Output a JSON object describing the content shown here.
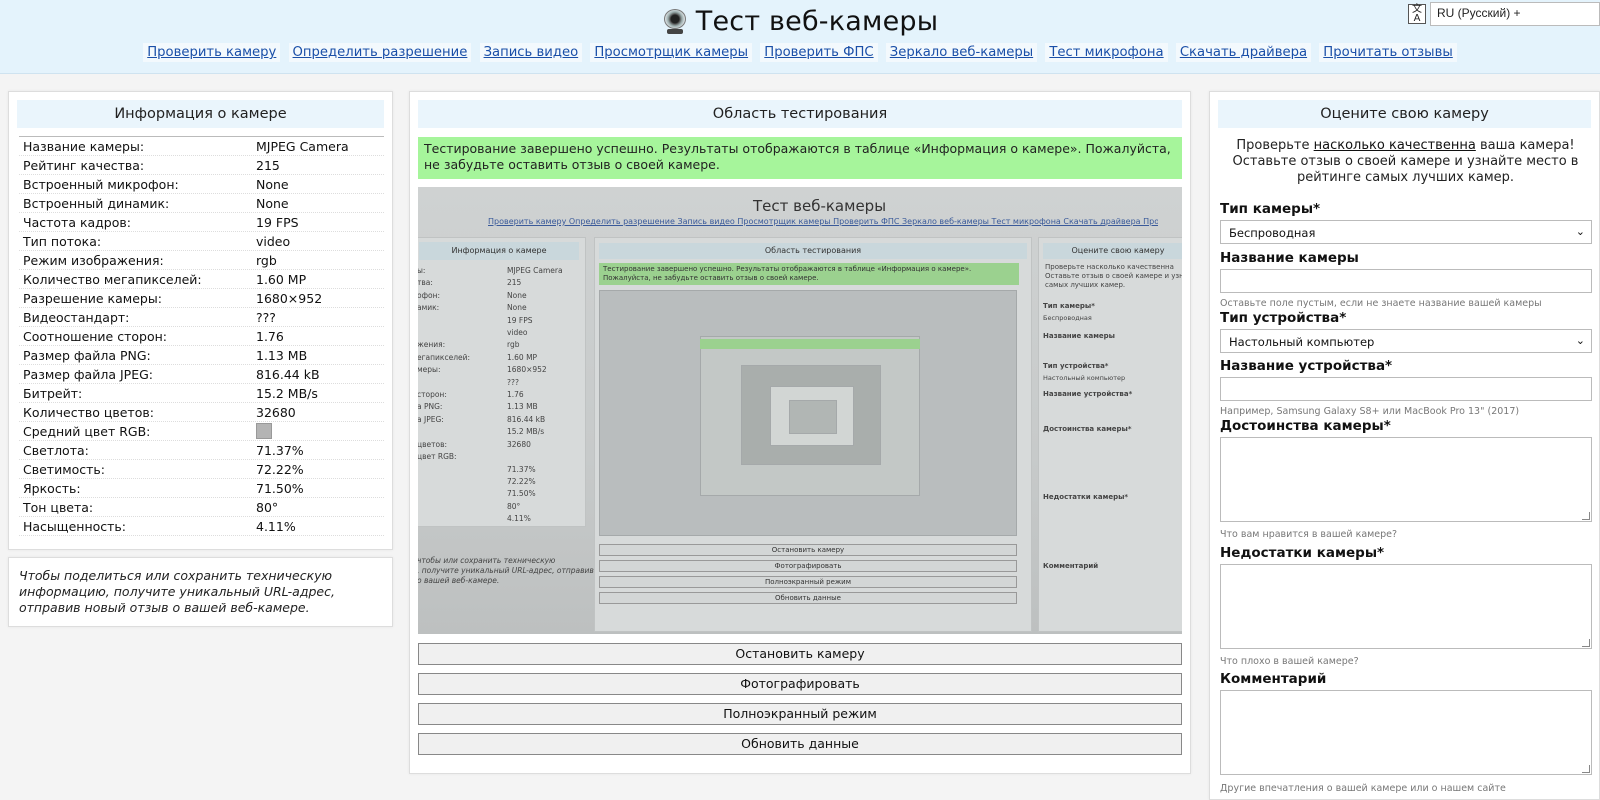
{
  "header": {
    "title": "Тест веб-камеры",
    "nav": [
      "Проверить камеру",
      "Определить разрешение",
      "Запись видео",
      "Просмотрщик камеры",
      "Проверить ФПС",
      "Зеркало веб-камеры",
      "Тест микрофона",
      "Скачать драйвера",
      "Прочитать отзывы"
    ],
    "lang_icon": "translate-icon",
    "lang_select": "RU (Русский) +"
  },
  "info": {
    "title": "Информация о камере",
    "rows": [
      {
        "k": "Название камеры:",
        "v": "MJPEG Camera"
      },
      {
        "k": "Рейтинг качества:",
        "v": "215"
      },
      {
        "k": "Встроенный микрофон:",
        "v": "None"
      },
      {
        "k": "Встроенный динамик:",
        "v": "None"
      },
      {
        "k": "Частота кадров:",
        "v": "19 FPS"
      },
      {
        "k": "Тип потока:",
        "v": "video"
      },
      {
        "k": "Режим изображения:",
        "v": "rgb"
      },
      {
        "k": "Количество мегапикселей:",
        "v": "1.60 MP"
      },
      {
        "k": "Разрешение камеры:",
        "v": "1680×952"
      },
      {
        "k": "Видеостандарт:",
        "v": "???"
      },
      {
        "k": "Соотношение сторон:",
        "v": "1.76"
      },
      {
        "k": "Размер файла PNG:",
        "v": "1.13 MB"
      },
      {
        "k": "Размер файла JPEG:",
        "v": "816.44 kB"
      },
      {
        "k": "Битрейт:",
        "v": "15.2 MB/s"
      },
      {
        "k": "Количество цветов:",
        "v": "32680"
      },
      {
        "k": "Средний цвет RGB:",
        "v": ""
      },
      {
        "k": "Светлота:",
        "v": "71.37%"
      },
      {
        "k": "Светимость:",
        "v": "72.22%"
      },
      {
        "k": "Яркость:",
        "v": "71.50%"
      },
      {
        "k": "Тон цвета:",
        "v": "80°"
      },
      {
        "k": "Насыщенность:",
        "v": "4.11%"
      }
    ],
    "avg_rgb_color": "#b4b4b4",
    "note": "Чтобы поделиться или сохранить техническую информацию, получите уникальный URL-адрес, отправив новый отзыв о вашей веб-камере."
  },
  "test": {
    "title": "Область тестирования",
    "success": "Тестирование завершено успешно. Результаты отображаются в таблице «Информация о камере». Пожалуйста, не забудьте оставить отзыв о своей камере.",
    "buttons": [
      "Остановить камеру",
      "Фотографировать",
      "Полноэкранный режим",
      "Обновить данные"
    ],
    "preview_nested": {
      "title": "Тест веб-камеры",
      "nav": "Проверить камеру   Определить разрешение   Запись видео   Просмотрщик камеры   Проверить ФПС   Зеркало веб-камеры   Тест микрофона   Скачать драйвера   Прочитать отзывы",
      "info_head": "Информация о камере",
      "area_head": "Область тестирования",
      "rate_head": "Оцените свою камеру",
      "green": "Тестирование завершено успешно. Результаты отображаются в таблице «Информация о камере». Пожалуйста, не забудьте оставить отзыв о своей камере.",
      "labels": "ы:\nтва:\nофон:\nамик:\n\n\nжения:\nегапикселей:\nмеры:\n\nсторон:\nа PNG:\nа JPEG:\n\nцветов:\nцвет RGB:",
      "values": "MJPEG Camera\n215\nNone\nNone\n19 FPS\nvideo\nrgb\n1.60 MP\n1680×952\n???\n1.76\n1.13 MB\n816.44 kB\n15.2 MB/s\n32680\n\n71.37%\n72.22%\n71.50%\n80°\n4.11%",
      "note": "чтобы или сохранить техническую\n, получите уникальный URL-адрес, отправив\nо вашей веб-камере.",
      "rate_intro": "Проверьте насколько качественна\nОставьте отзыв о своей камере и узнайте\nсамых лучших камер.",
      "form_labels": [
        "Тип камеры*",
        "Беспроводная",
        "Название камеры",
        "Тип устройства*",
        "Настольный компьютер",
        "Название устройства*",
        "Достоинства камеры*",
        "Недостатки камеры*",
        "Комментарий"
      ],
      "buttons": [
        "Остановить камеру",
        "Фотографировать",
        "Полноэкранный режим",
        "Обновить данные"
      ]
    }
  },
  "rate": {
    "title": "Оцените свою камеру",
    "intro_pre": "Проверьте ",
    "intro_link": "насколько качественна",
    "intro_post": " ваша камера!",
    "intro_2": "Оставьте отзыв о своей камере и узнайте место в рейтинге самых лучших камер.",
    "camera_type_label": "Тип камеры*",
    "camera_type_value": "Беспроводная",
    "camera_name_label": "Название камеры",
    "camera_name_hint": "Оставьте поле пустым, если не знаете название вашей камеры",
    "device_type_label": "Тип устройства*",
    "device_type_value": "Настольный компьютер",
    "device_name_label": "Название устройства*",
    "device_name_hint": "Например, Samsung Galaxy S8+ или MacBook Pro 13\" (2017)",
    "pros_label": "Достоинства камеры*",
    "pros_hint": "Что вам нравится в вашей камере?",
    "cons_label": "Недостатки камеры*",
    "cons_hint": "Что плохо в вашей камере?",
    "comment_label": "Комментарий",
    "comment_hint": "Другие впечатления о вашей камере или о нашем сайте"
  }
}
